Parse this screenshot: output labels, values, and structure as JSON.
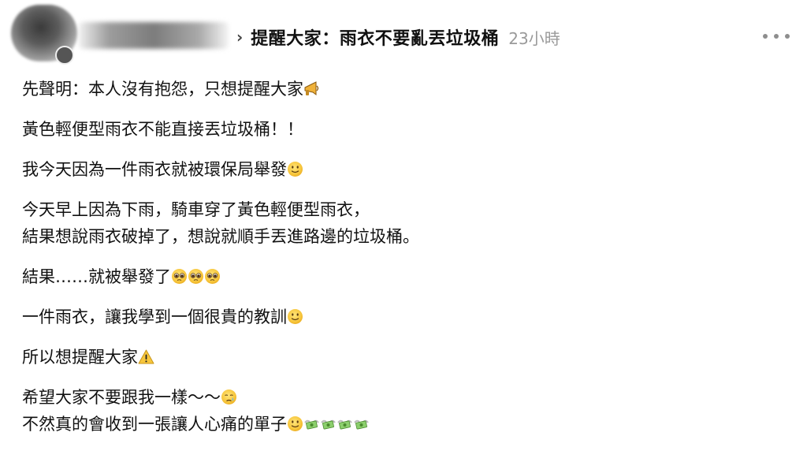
{
  "header": {
    "title": "提醒大家：雨衣不要亂丟垃圾桶",
    "time": "23小時"
  },
  "body": {
    "para1": "先聲明：本人沒有抱怨，只想提醒大家",
    "para2": "黃色輕便型雨衣不能直接丟垃圾桶！！",
    "para3": "我今天因為一件雨衣就被環保局舉發",
    "para4_line1": "今天早上因為下雨，騎車穿了黃色輕便型雨衣，",
    "para4_line2": "結果想說雨衣破掉了，想說就順手丟進路邊的垃圾桶。",
    "para5": "結果……就被舉發了",
    "para6": "一件雨衣，讓我學到一個很貴的教訓",
    "para7": "所以想提醒大家",
    "para8_line1": "希望大家不要跟我一樣～～",
    "para8_line2": "不然真的會收到一張讓人心痛的單子"
  },
  "icons": {
    "megaphone": "megaphone-icon",
    "smile": "slightly-smiling-face-icon",
    "pleading": "pleading-face-icon",
    "warning": "warning-icon",
    "crying": "crying-face-icon",
    "money": "money-with-wings-icon"
  },
  "colors": {
    "text": "#111111",
    "muted": "#9a9a9a",
    "emoji_yellow": "#f7c63c"
  }
}
